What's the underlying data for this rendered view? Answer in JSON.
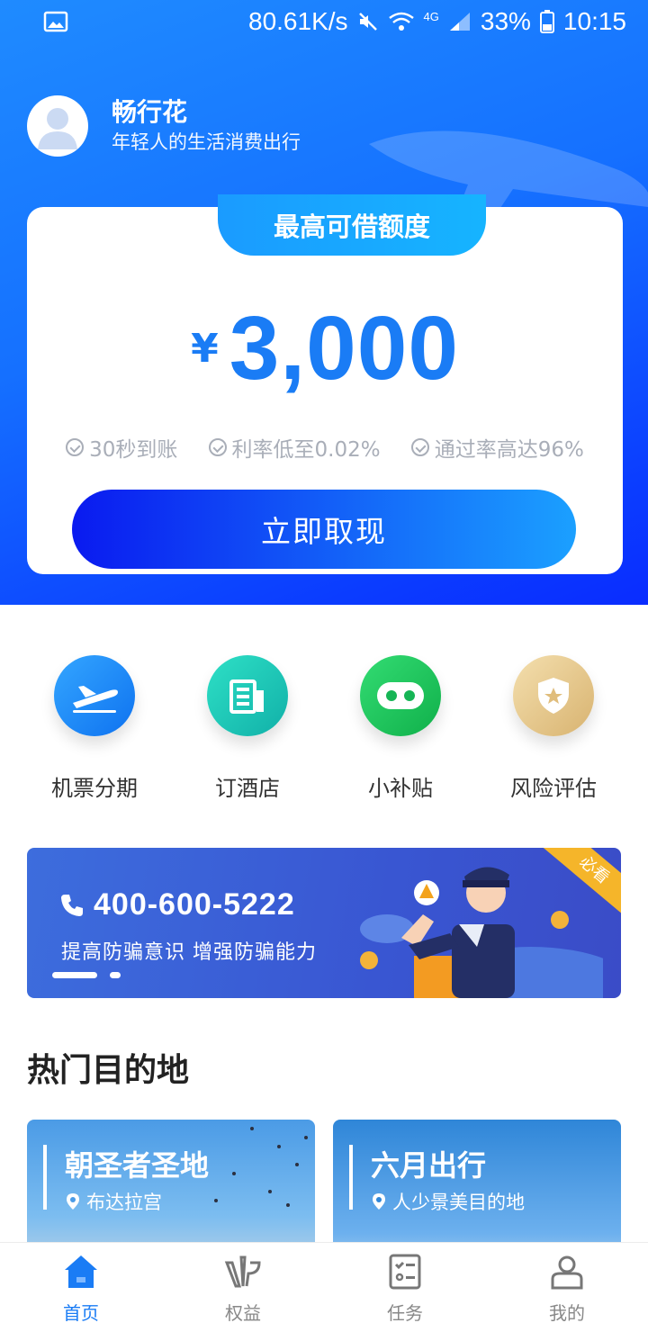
{
  "status_bar": {
    "net_speed": "80.61K/s",
    "signal": "4G",
    "battery": "33%",
    "time": "10:15"
  },
  "profile": {
    "app_name": "畅行花",
    "slogan": "年轻人的生活消费出行"
  },
  "credit_card": {
    "tab_label": "最高可借额度",
    "currency": "¥",
    "amount": "3,000",
    "features": [
      "30秒到账",
      "利率低至0.02%",
      "通过率高达96%"
    ],
    "button_label": "立即取现"
  },
  "services": [
    {
      "label": "机票分期",
      "icon": "airplane-icon",
      "color": "#1a8cff"
    },
    {
      "label": "订酒店",
      "icon": "hotel-icon",
      "color": "#19c7b5"
    },
    {
      "label": "小补贴",
      "icon": "subsidy-icon",
      "color": "#1fc45e"
    },
    {
      "label": "风险评估",
      "icon": "shield-icon",
      "color": "#e6c585"
    }
  ],
  "banner": {
    "phone": "400-600-5222",
    "subtitle": "提高防骗意识  增强防骗能力",
    "ribbon": "必看",
    "slides": 2,
    "active_slide": 1
  },
  "destinations": {
    "title": "热门目的地",
    "items": [
      {
        "title": "朝圣者圣地",
        "location": "布达拉宫"
      },
      {
        "title": "六月出行",
        "location": "人少景美目的地"
      }
    ]
  },
  "tabbar": {
    "items": [
      {
        "label": "首页",
        "icon": "home-icon",
        "active": true
      },
      {
        "label": "权益",
        "icon": "vip-icon",
        "active": false
      },
      {
        "label": "任务",
        "icon": "task-icon",
        "active": false
      },
      {
        "label": "我的",
        "icon": "user-icon",
        "active": false
      }
    ]
  },
  "colors": {
    "primary": "#1a7cf5",
    "hero_start": "#1f8bff",
    "hero_end": "#0a2cff",
    "banner": "#3956d2"
  }
}
